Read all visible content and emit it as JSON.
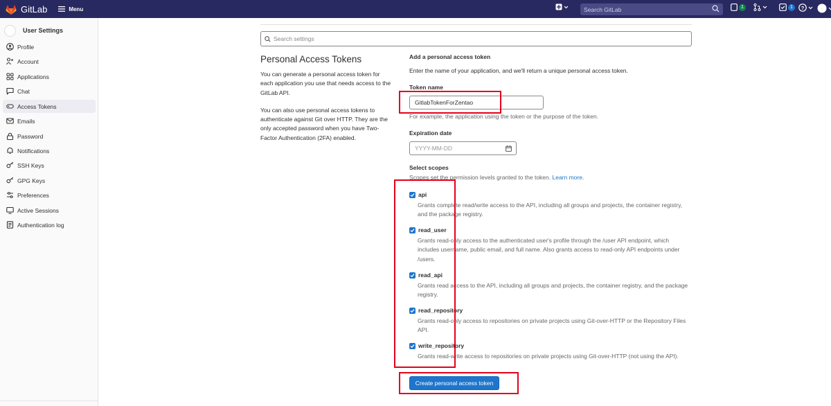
{
  "header": {
    "app_name": "GitLab",
    "menu_label": "Menu",
    "search_placeholder": "Search GitLab",
    "mr_count": "1",
    "todo_count": "1",
    "brand_color": "#292961"
  },
  "sidebar": {
    "title": "User Settings",
    "items": [
      {
        "label": "Profile",
        "icon": "profile-icon"
      },
      {
        "label": "Account",
        "icon": "account-icon"
      },
      {
        "label": "Applications",
        "icon": "applications-icon"
      },
      {
        "label": "Chat",
        "icon": "chat-icon"
      },
      {
        "label": "Access Tokens",
        "icon": "token-icon",
        "active": true
      },
      {
        "label": "Emails",
        "icon": "mail-icon"
      },
      {
        "label": "Password",
        "icon": "lock-icon"
      },
      {
        "label": "Notifications",
        "icon": "bell-icon"
      },
      {
        "label": "SSH Keys",
        "icon": "key-icon"
      },
      {
        "label": "GPG Keys",
        "icon": "key-icon"
      },
      {
        "label": "Preferences",
        "icon": "preferences-icon"
      },
      {
        "label": "Active Sessions",
        "icon": "sessions-icon"
      },
      {
        "label": "Authentication log",
        "icon": "log-icon"
      }
    ]
  },
  "main": {
    "settings_search_placeholder": "Search settings",
    "title": "Personal Access Tokens",
    "desc1": "You can generate a personal access token for each application you use that needs access to the GitLab API.",
    "desc2": "You can also use personal access tokens to authenticate against Git over HTTP. They are the only accepted password when you have Two-Factor Authentication (2FA) enabled.",
    "add_heading": "Add a personal access token",
    "add_intro": "Enter the name of your application, and we'll return a unique personal access token.",
    "token_name_label": "Token name",
    "token_name_value": "GitlabTokenForZentao",
    "token_name_hint": "For example, the application using the token or the purpose of the token.",
    "expiration_label": "Expiration date",
    "expiration_placeholder": "YYYY-MM-DD",
    "scopes_label": "Select scopes",
    "scopes_hint": "Scopes set the permission levels granted to the token.",
    "learn_more": "Learn more.",
    "scopes": [
      {
        "name": "api",
        "checked": true,
        "desc": "Grants complete read/write access to the API, including all groups and projects, the container registry, and the package registry."
      },
      {
        "name": "read_user",
        "checked": true,
        "desc": "Grants read-only access to the authenticated user's profile through the /user API endpoint, which includes username, public email, and full name. Also grants access to read-only API endpoints under /users."
      },
      {
        "name": "read_api",
        "checked": true,
        "desc": "Grants read access to the API, including all groups and projects, the container registry, and the package registry."
      },
      {
        "name": "read_repository",
        "checked": true,
        "desc": "Grants read-only access to repositories on private projects using Git-over-HTTP or the Repository Files API."
      },
      {
        "name": "write_repository",
        "checked": true,
        "desc": "Grants read-write access to repositories on private projects using Git-over-HTTP (not using the API)."
      }
    ],
    "create_button": "Create personal access token",
    "accent_color": "#1f75cb",
    "highlight_color": "#e3001b"
  }
}
